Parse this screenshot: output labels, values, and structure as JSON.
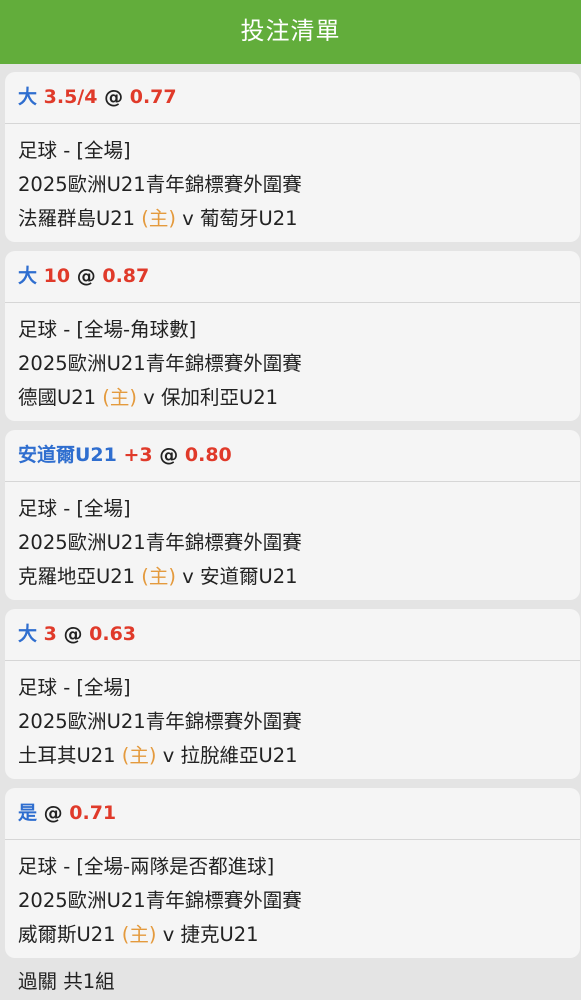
{
  "header": {
    "title": "投注清單"
  },
  "bets": [
    {
      "pick": "大",
      "line": "3.5/4",
      "at": "@",
      "odds": "0.77",
      "market": "足球 - [全場]",
      "league": "2025歐洲U21青年錦標賽外圍賽",
      "home_team": "法羅群島U21",
      "home_tag": "(主)",
      "vs": "v",
      "away_team": "葡萄牙U21"
    },
    {
      "pick": "大",
      "line": "10",
      "at": "@",
      "odds": "0.87",
      "market": "足球 - [全場-角球數]",
      "league": "2025歐洲U21青年錦標賽外圍賽",
      "home_team": "德國U21",
      "home_tag": "(主)",
      "vs": "v",
      "away_team": "保加利亞U21"
    },
    {
      "pick": "安道爾U21",
      "line": "+3",
      "at": "@",
      "odds": "0.80",
      "market": "足球 - [全場]",
      "league": "2025歐洲U21青年錦標賽外圍賽",
      "home_team": "克羅地亞U21",
      "home_tag": "(主)",
      "vs": "v",
      "away_team": "安道爾U21"
    },
    {
      "pick": "大",
      "line": "3",
      "at": "@",
      "odds": "0.63",
      "market": "足球 - [全場]",
      "league": "2025歐洲U21青年錦標賽外圍賽",
      "home_team": "土耳其U21",
      "home_tag": "(主)",
      "vs": "v",
      "away_team": "拉脫維亞U21"
    },
    {
      "pick": "是",
      "line": "",
      "at": "@",
      "odds": "0.71",
      "market": "足球 - [全場-兩隊是否都進球]",
      "league": "2025歐洲U21青年錦標賽外圍賽",
      "home_team": "威爾斯U21",
      "home_tag": "(主)",
      "vs": "v",
      "away_team": "捷克U21"
    }
  ],
  "footer": {
    "parlay_text": "過關 共1組"
  },
  "colors": {
    "header_bg": "#62ad3b",
    "pick": "#2f6ecf",
    "odds": "#e03a2a",
    "home_tag": "#e49a3d"
  }
}
